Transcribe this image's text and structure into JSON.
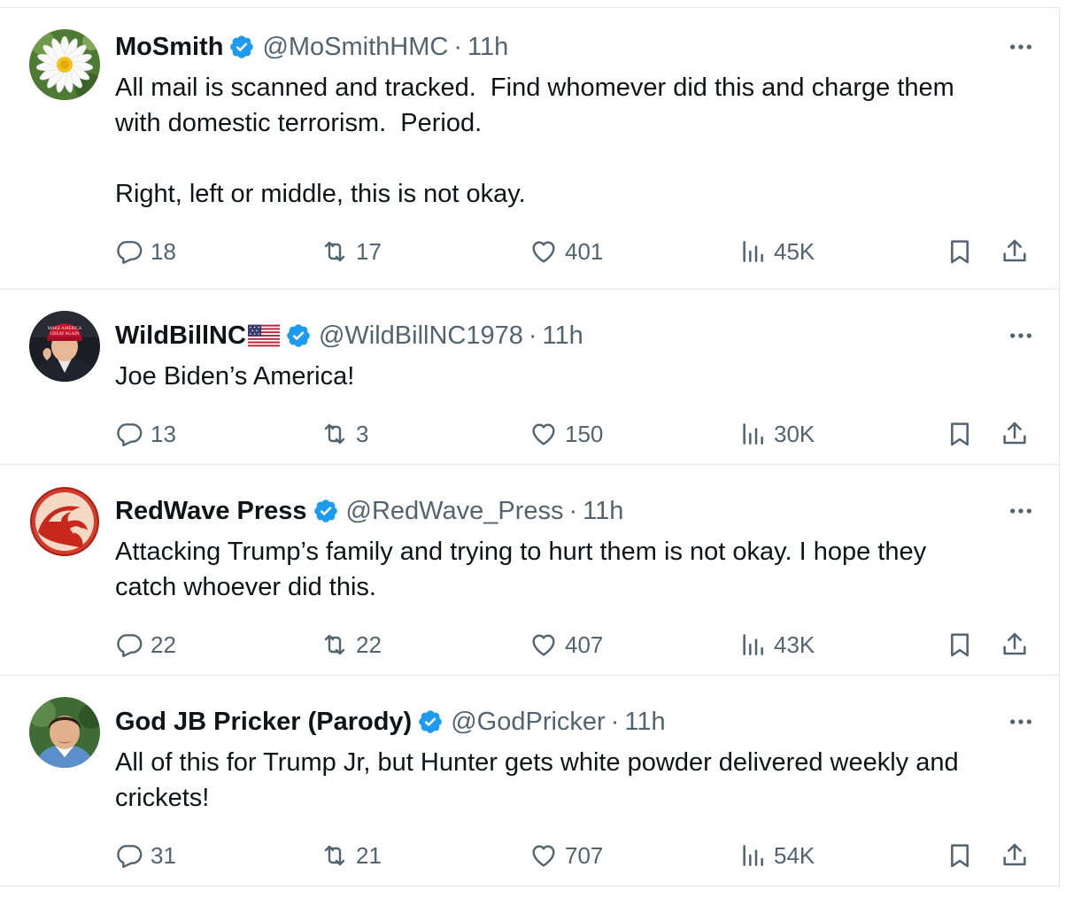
{
  "tweets": [
    {
      "name": "MoSmith",
      "flag": "",
      "handle": "@MoSmithHMC",
      "dot": "·",
      "time": "11h",
      "text": "All mail is scanned and tracked.  Find whomever did this and charge them\nwith domestic terrorism.  Period.\n\nRight, left or middle, this is not okay.",
      "replies": "18",
      "retweets": "17",
      "likes": "401",
      "views": "45K",
      "avatar_icon": "daisy-flower-photo"
    },
    {
      "name": "WildBillNC",
      "flag": "us-flag-emoji",
      "handle": "@WildBillNC1978",
      "dot": "·",
      "time": "11h",
      "text": "Joe Biden’s America!",
      "replies": "13",
      "retweets": "3",
      "likes": "150",
      "views": "30K",
      "avatar_icon": "man-red-cap-photo"
    },
    {
      "name": "RedWave Press",
      "flag": "",
      "handle": "@RedWave_Press",
      "dot": "·",
      "time": "11h",
      "text": "Attacking Trump’s family and trying to hurt them is not okay. I hope they\ncatch whoever did this.",
      "replies": "22",
      "retweets": "22",
      "likes": "407",
      "views": "43K",
      "avatar_icon": "red-wave-logo"
    },
    {
      "name": "God JB Pricker (Parody)",
      "flag": "",
      "handle": "@GodPricker",
      "dot": "·",
      "time": "11h",
      "text": "All of this for Trump Jr, but Hunter gets white powder delivered weekly and\ncrickets!",
      "replies": "31",
      "retweets": "21",
      "likes": "707",
      "views": "54K",
      "avatar_icon": "man-portrait-photo"
    }
  ],
  "colors": {
    "text_primary": "#0f1419",
    "text_secondary": "#536471",
    "verified_blue": "#1d9bf0",
    "divider": "#e6e9ec"
  }
}
